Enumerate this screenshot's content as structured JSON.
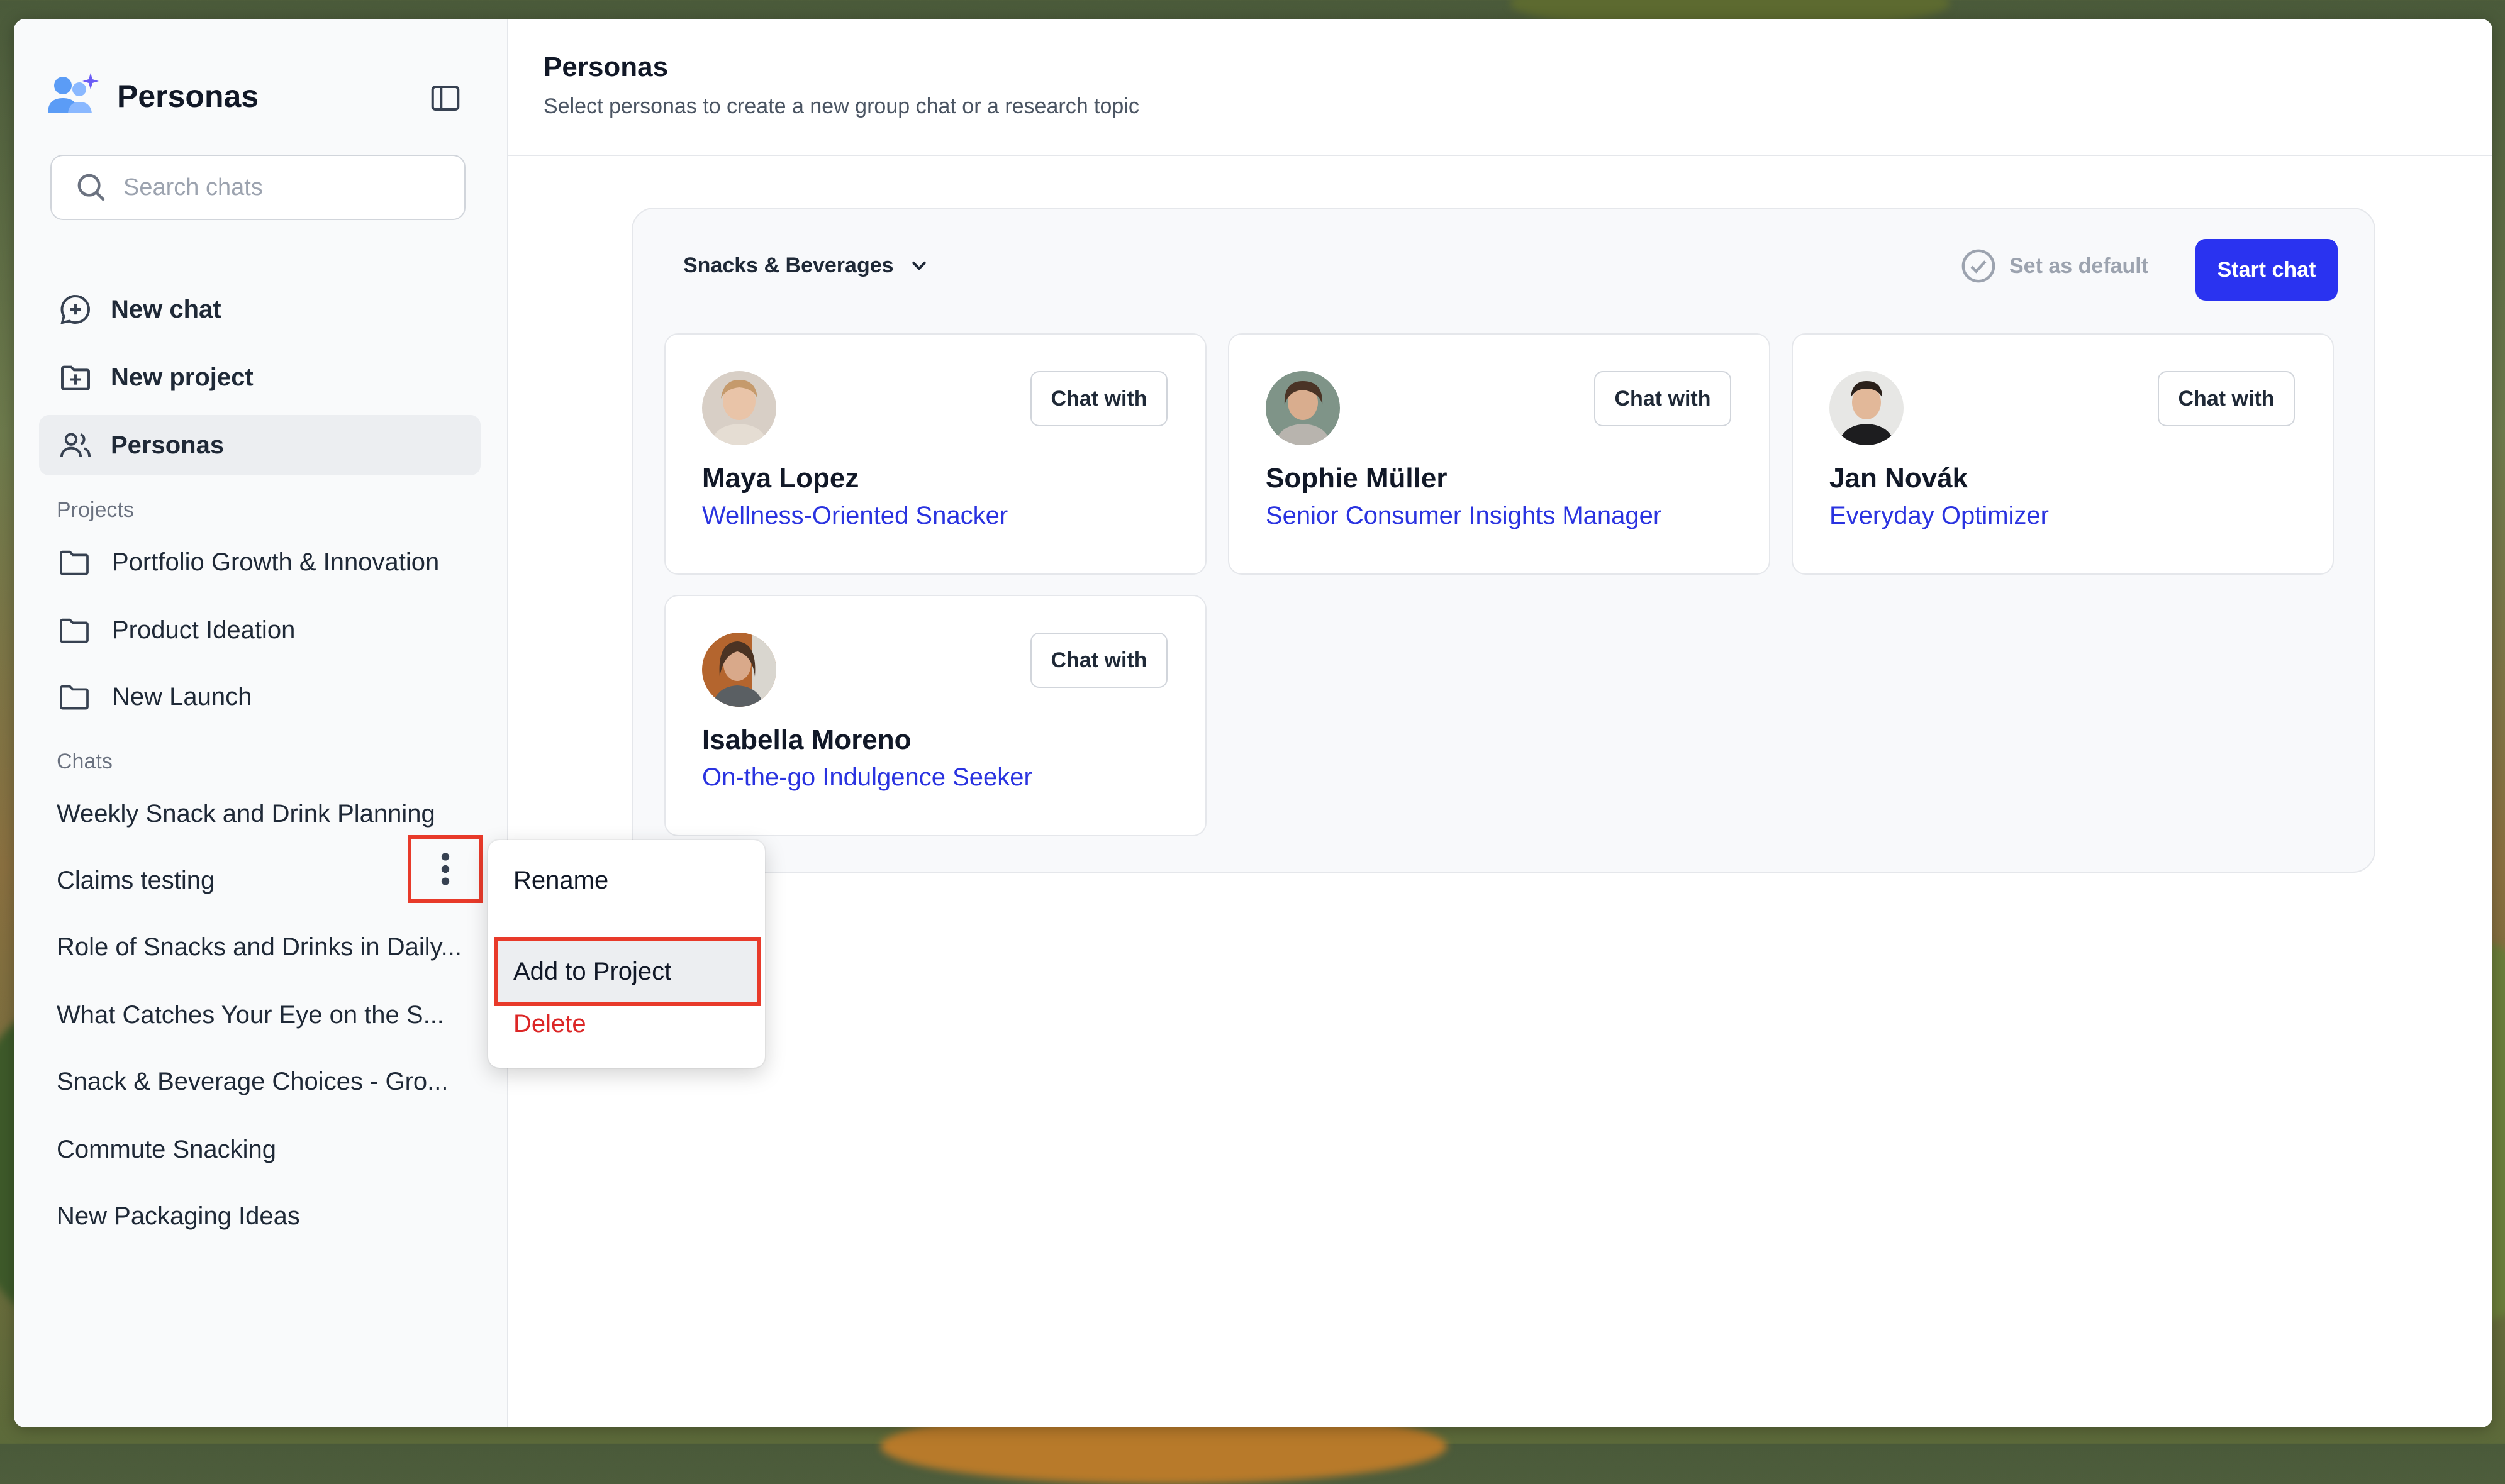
{
  "sidebar": {
    "brand": "Personas",
    "search_placeholder": "Search chats",
    "nav": {
      "new_chat": "New chat",
      "new_project": "New project",
      "personas": "Personas"
    },
    "projects_label": "Projects",
    "projects": [
      "Portfolio Growth & Innovation",
      "Product Ideation",
      "New Launch"
    ],
    "chats_label": "Chats",
    "chats": [
      "Weekly Snack and Drink Planning",
      "Claims testing",
      "Role of Snacks and Drinks in Daily...",
      "What Catches Your Eye on the S...",
      "Snack & Beverage Choices - Gro...",
      "Commute Snacking",
      "New Packaging Ideas"
    ]
  },
  "context_menu": {
    "rename": "Rename",
    "add_to_project": "Add to Project",
    "delete": "Delete"
  },
  "header": {
    "title": "Personas",
    "subtitle": "Select personas to create a new group chat or a research topic"
  },
  "panel": {
    "category": "Snacks & Beverages",
    "set_default": "Set as default",
    "start_chat": "Start chat",
    "chat_with_label": "Chat with",
    "personas": [
      {
        "name": "Maya Lopez",
        "role": "Wellness-Oriented Snacker"
      },
      {
        "name": "Sophie Müller",
        "role": "Senior Consumer Insights Manager"
      },
      {
        "name": "Jan Novák",
        "role": "Everyday Optimizer"
      },
      {
        "name": "Isabella Moreno",
        "role": "On-the-go Indulgence Seeker"
      }
    ]
  },
  "colors": {
    "accent": "#2a33f0",
    "link": "#2a33e0",
    "danger": "#dc2626",
    "highlight_border": "#e83a2a"
  }
}
